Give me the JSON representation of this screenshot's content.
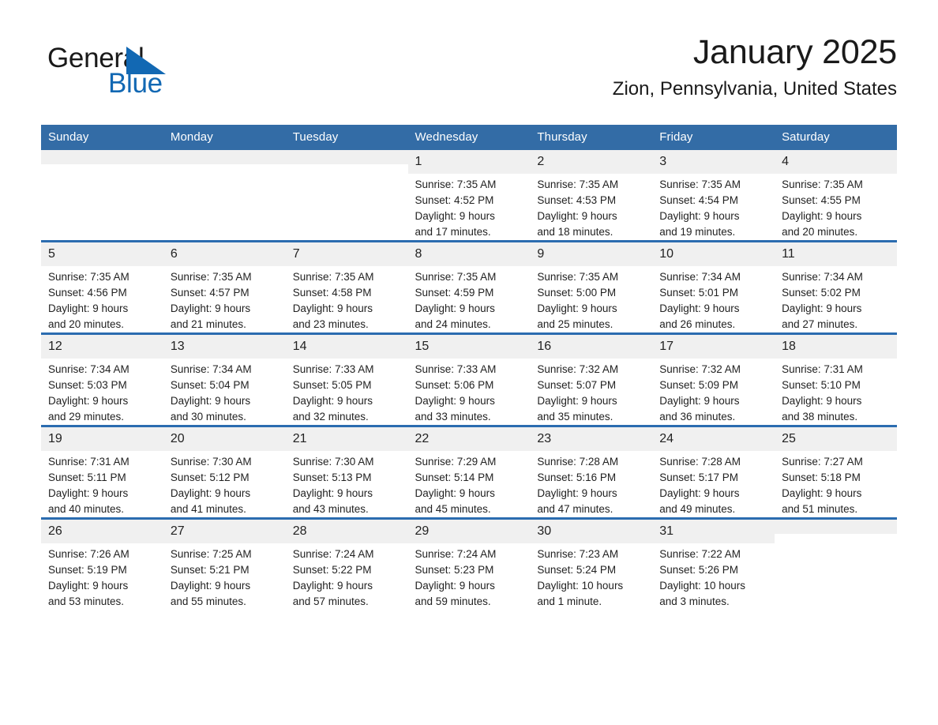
{
  "brand": {
    "name_part1": "General",
    "name_part2": "Blue",
    "triangle_icon": "triangle-icon",
    "accent_color": "#1268b3"
  },
  "header": {
    "month_title": "January 2025",
    "location": "Zion, Pennsylvania, United States"
  },
  "colors": {
    "header_row_bg": "#336ca6",
    "week_divider": "#2b6cb0",
    "daynum_bg": "#f0f0f0",
    "text": "#222222"
  },
  "weekdays": [
    "Sunday",
    "Monday",
    "Tuesday",
    "Wednesday",
    "Thursday",
    "Friday",
    "Saturday"
  ],
  "weeks": [
    [
      {
        "day": "",
        "sunrise": "",
        "sunset": "",
        "daylight1": "",
        "daylight2": ""
      },
      {
        "day": "",
        "sunrise": "",
        "sunset": "",
        "daylight1": "",
        "daylight2": ""
      },
      {
        "day": "",
        "sunrise": "",
        "sunset": "",
        "daylight1": "",
        "daylight2": ""
      },
      {
        "day": "1",
        "sunrise": "Sunrise: 7:35 AM",
        "sunset": "Sunset: 4:52 PM",
        "daylight1": "Daylight: 9 hours",
        "daylight2": "and 17 minutes."
      },
      {
        "day": "2",
        "sunrise": "Sunrise: 7:35 AM",
        "sunset": "Sunset: 4:53 PM",
        "daylight1": "Daylight: 9 hours",
        "daylight2": "and 18 minutes."
      },
      {
        "day": "3",
        "sunrise": "Sunrise: 7:35 AM",
        "sunset": "Sunset: 4:54 PM",
        "daylight1": "Daylight: 9 hours",
        "daylight2": "and 19 minutes."
      },
      {
        "day": "4",
        "sunrise": "Sunrise: 7:35 AM",
        "sunset": "Sunset: 4:55 PM",
        "daylight1": "Daylight: 9 hours",
        "daylight2": "and 20 minutes."
      }
    ],
    [
      {
        "day": "5",
        "sunrise": "Sunrise: 7:35 AM",
        "sunset": "Sunset: 4:56 PM",
        "daylight1": "Daylight: 9 hours",
        "daylight2": "and 20 minutes."
      },
      {
        "day": "6",
        "sunrise": "Sunrise: 7:35 AM",
        "sunset": "Sunset: 4:57 PM",
        "daylight1": "Daylight: 9 hours",
        "daylight2": "and 21 minutes."
      },
      {
        "day": "7",
        "sunrise": "Sunrise: 7:35 AM",
        "sunset": "Sunset: 4:58 PM",
        "daylight1": "Daylight: 9 hours",
        "daylight2": "and 23 minutes."
      },
      {
        "day": "8",
        "sunrise": "Sunrise: 7:35 AM",
        "sunset": "Sunset: 4:59 PM",
        "daylight1": "Daylight: 9 hours",
        "daylight2": "and 24 minutes."
      },
      {
        "day": "9",
        "sunrise": "Sunrise: 7:35 AM",
        "sunset": "Sunset: 5:00 PM",
        "daylight1": "Daylight: 9 hours",
        "daylight2": "and 25 minutes."
      },
      {
        "day": "10",
        "sunrise": "Sunrise: 7:34 AM",
        "sunset": "Sunset: 5:01 PM",
        "daylight1": "Daylight: 9 hours",
        "daylight2": "and 26 minutes."
      },
      {
        "day": "11",
        "sunrise": "Sunrise: 7:34 AM",
        "sunset": "Sunset: 5:02 PM",
        "daylight1": "Daylight: 9 hours",
        "daylight2": "and 27 minutes."
      }
    ],
    [
      {
        "day": "12",
        "sunrise": "Sunrise: 7:34 AM",
        "sunset": "Sunset: 5:03 PM",
        "daylight1": "Daylight: 9 hours",
        "daylight2": "and 29 minutes."
      },
      {
        "day": "13",
        "sunrise": "Sunrise: 7:34 AM",
        "sunset": "Sunset: 5:04 PM",
        "daylight1": "Daylight: 9 hours",
        "daylight2": "and 30 minutes."
      },
      {
        "day": "14",
        "sunrise": "Sunrise: 7:33 AM",
        "sunset": "Sunset: 5:05 PM",
        "daylight1": "Daylight: 9 hours",
        "daylight2": "and 32 minutes."
      },
      {
        "day": "15",
        "sunrise": "Sunrise: 7:33 AM",
        "sunset": "Sunset: 5:06 PM",
        "daylight1": "Daylight: 9 hours",
        "daylight2": "and 33 minutes."
      },
      {
        "day": "16",
        "sunrise": "Sunrise: 7:32 AM",
        "sunset": "Sunset: 5:07 PM",
        "daylight1": "Daylight: 9 hours",
        "daylight2": "and 35 minutes."
      },
      {
        "day": "17",
        "sunrise": "Sunrise: 7:32 AM",
        "sunset": "Sunset: 5:09 PM",
        "daylight1": "Daylight: 9 hours",
        "daylight2": "and 36 minutes."
      },
      {
        "day": "18",
        "sunrise": "Sunrise: 7:31 AM",
        "sunset": "Sunset: 5:10 PM",
        "daylight1": "Daylight: 9 hours",
        "daylight2": "and 38 minutes."
      }
    ],
    [
      {
        "day": "19",
        "sunrise": "Sunrise: 7:31 AM",
        "sunset": "Sunset: 5:11 PM",
        "daylight1": "Daylight: 9 hours",
        "daylight2": "and 40 minutes."
      },
      {
        "day": "20",
        "sunrise": "Sunrise: 7:30 AM",
        "sunset": "Sunset: 5:12 PM",
        "daylight1": "Daylight: 9 hours",
        "daylight2": "and 41 minutes."
      },
      {
        "day": "21",
        "sunrise": "Sunrise: 7:30 AM",
        "sunset": "Sunset: 5:13 PM",
        "daylight1": "Daylight: 9 hours",
        "daylight2": "and 43 minutes."
      },
      {
        "day": "22",
        "sunrise": "Sunrise: 7:29 AM",
        "sunset": "Sunset: 5:14 PM",
        "daylight1": "Daylight: 9 hours",
        "daylight2": "and 45 minutes."
      },
      {
        "day": "23",
        "sunrise": "Sunrise: 7:28 AM",
        "sunset": "Sunset: 5:16 PM",
        "daylight1": "Daylight: 9 hours",
        "daylight2": "and 47 minutes."
      },
      {
        "day": "24",
        "sunrise": "Sunrise: 7:28 AM",
        "sunset": "Sunset: 5:17 PM",
        "daylight1": "Daylight: 9 hours",
        "daylight2": "and 49 minutes."
      },
      {
        "day": "25",
        "sunrise": "Sunrise: 7:27 AM",
        "sunset": "Sunset: 5:18 PM",
        "daylight1": "Daylight: 9 hours",
        "daylight2": "and 51 minutes."
      }
    ],
    [
      {
        "day": "26",
        "sunrise": "Sunrise: 7:26 AM",
        "sunset": "Sunset: 5:19 PM",
        "daylight1": "Daylight: 9 hours",
        "daylight2": "and 53 minutes."
      },
      {
        "day": "27",
        "sunrise": "Sunrise: 7:25 AM",
        "sunset": "Sunset: 5:21 PM",
        "daylight1": "Daylight: 9 hours",
        "daylight2": "and 55 minutes."
      },
      {
        "day": "28",
        "sunrise": "Sunrise: 7:24 AM",
        "sunset": "Sunset: 5:22 PM",
        "daylight1": "Daylight: 9 hours",
        "daylight2": "and 57 minutes."
      },
      {
        "day": "29",
        "sunrise": "Sunrise: 7:24 AM",
        "sunset": "Sunset: 5:23 PM",
        "daylight1": "Daylight: 9 hours",
        "daylight2": "and 59 minutes."
      },
      {
        "day": "30",
        "sunrise": "Sunrise: 7:23 AM",
        "sunset": "Sunset: 5:24 PM",
        "daylight1": "Daylight: 10 hours",
        "daylight2": "and 1 minute."
      },
      {
        "day": "31",
        "sunrise": "Sunrise: 7:22 AM",
        "sunset": "Sunset: 5:26 PM",
        "daylight1": "Daylight: 10 hours",
        "daylight2": "and 3 minutes."
      },
      {
        "day": "",
        "sunrise": "",
        "sunset": "",
        "daylight1": "",
        "daylight2": ""
      }
    ]
  ]
}
